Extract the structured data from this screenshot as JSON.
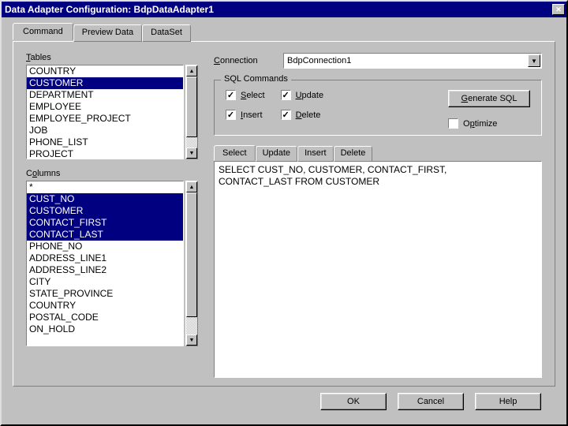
{
  "title": "Data Adapter Configuration: BdpDataAdapter1",
  "main_tabs": [
    {
      "label": "Command"
    },
    {
      "label": "Preview Data"
    },
    {
      "label": "DataSet"
    }
  ],
  "tables_label": "Tables",
  "columns_label": "Columns",
  "tables": [
    {
      "name": "COUNTRY",
      "selected": false
    },
    {
      "name": "CUSTOMER",
      "selected": true
    },
    {
      "name": "DEPARTMENT",
      "selected": false
    },
    {
      "name": "EMPLOYEE",
      "selected": false
    },
    {
      "name": "EMPLOYEE_PROJECT",
      "selected": false
    },
    {
      "name": "JOB",
      "selected": false
    },
    {
      "name": "PHONE_LIST",
      "selected": false
    },
    {
      "name": "PROJECT",
      "selected": false
    }
  ],
  "columns": [
    {
      "name": "*",
      "selected": false
    },
    {
      "name": "CUST_NO",
      "selected": true
    },
    {
      "name": "CUSTOMER",
      "selected": true
    },
    {
      "name": "CONTACT_FIRST",
      "selected": true
    },
    {
      "name": "CONTACT_LAST",
      "selected": true
    },
    {
      "name": "PHONE_NO",
      "selected": false
    },
    {
      "name": "ADDRESS_LINE1",
      "selected": false
    },
    {
      "name": "ADDRESS_LINE2",
      "selected": false
    },
    {
      "name": "CITY",
      "selected": false
    },
    {
      "name": "STATE_PROVINCE",
      "selected": false
    },
    {
      "name": "COUNTRY",
      "selected": false
    },
    {
      "name": "POSTAL_CODE",
      "selected": false
    },
    {
      "name": "ON_HOLD",
      "selected": false
    }
  ],
  "connection_label": "Connection",
  "connection_value": "BdpConnection1",
  "sql_commands_label": "SQL Commands",
  "sql_checks": {
    "select": {
      "label": "Select",
      "checked": true
    },
    "update": {
      "label": "Update",
      "checked": true
    },
    "insert": {
      "label": "Insert",
      "checked": true
    },
    "delete": {
      "label": "Delete",
      "checked": true
    }
  },
  "generate_label": "Generate SQL",
  "optimize": {
    "label": "Optimize",
    "checked": false
  },
  "sql_tabs": [
    {
      "label": "Select"
    },
    {
      "label": "Update"
    },
    {
      "label": "Insert"
    },
    {
      "label": "Delete"
    }
  ],
  "sql_text": "SELECT CUST_NO, CUSTOMER, CONTACT_FIRST,\nCONTACT_LAST FROM CUSTOMER",
  "buttons": {
    "ok": "OK",
    "cancel": "Cancel",
    "help": "Help"
  }
}
